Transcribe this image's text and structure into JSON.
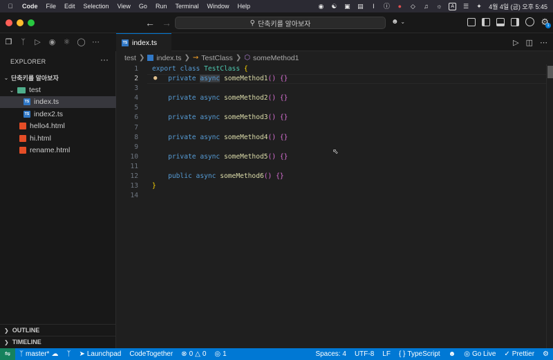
{
  "macos_menubar": {
    "app_name": "Code",
    "menus": [
      "File",
      "Edit",
      "Selection",
      "View",
      "Go",
      "Run",
      "Terminal",
      "Window",
      "Help"
    ],
    "clock": "4월 4일 (금) 오후 5:45",
    "input_badge": "A",
    "status_icons": [
      "record-icon",
      "bug-icon",
      "window-icon",
      "clipboard-icon",
      "cursor-icon",
      "info-icon",
      "profile-icon",
      "layers-icon",
      "wifi-icon",
      "keyboard-icon",
      "control-center-icon",
      "siri-icon"
    ]
  },
  "titlebar": {
    "search_text": "단축키를 알아보자",
    "colors": {
      "close": "#ff5f57",
      "minimize": "#febc2e",
      "maximize": "#28c840"
    },
    "notification_badge": "1"
  },
  "activity_bar": {
    "icons": [
      "files-icon",
      "source-control-icon",
      "run-debug-icon",
      "github-icon",
      "extensions-icon",
      "remote-icon",
      "more-icon"
    ]
  },
  "sidebar": {
    "title": "EXPLORER",
    "more": "···",
    "workspace": "단축키를 알아보자",
    "tree": [
      {
        "label": "test",
        "type": "folder",
        "indent": 1,
        "expanded": true
      },
      {
        "label": "index.ts",
        "type": "ts",
        "indent": 2,
        "selected": true
      },
      {
        "label": "index2.ts",
        "type": "ts",
        "indent": 2
      },
      {
        "label": "hello4.html",
        "type": "html",
        "indent": 1
      },
      {
        "label": "hi.html",
        "type": "html",
        "indent": 1
      },
      {
        "label": "rename.html",
        "type": "html",
        "indent": 1
      }
    ],
    "outline": "OUTLINE",
    "timeline": "TIMELINE"
  },
  "editor_tab": {
    "label": "index.ts",
    "icon_text": "TS"
  },
  "breadcrumb": {
    "folder": "test",
    "file": "index.ts",
    "class": "TestClass",
    "method": "someMethod1"
  },
  "code": {
    "line_numbers": [
      "1",
      "2",
      "3",
      "4",
      "5",
      "6",
      "7",
      "8",
      "9",
      "10",
      "11",
      "12",
      "13",
      "14"
    ],
    "current_line": "2",
    "lines": [
      {
        "parts": [
          [
            "kw",
            "export"
          ],
          [
            "p",
            " "
          ],
          [
            "kw",
            "class"
          ],
          [
            "p",
            " "
          ],
          [
            "cls",
            "TestClass"
          ],
          [
            "p",
            " "
          ],
          [
            "br1",
            "{"
          ]
        ]
      },
      {
        "parts": [
          [
            "p",
            "    "
          ],
          [
            "kw",
            "private"
          ],
          [
            "p",
            " "
          ],
          [
            "sel",
            "async"
          ],
          [
            "p",
            " "
          ],
          [
            "fn",
            "someMethod1"
          ],
          [
            "br2",
            "()"
          ],
          [
            "p",
            " "
          ],
          [
            "br2",
            "{}"
          ]
        ]
      },
      {
        "parts": []
      },
      {
        "parts": [
          [
            "p",
            "    "
          ],
          [
            "kw",
            "private"
          ],
          [
            "p",
            " "
          ],
          [
            "kw",
            "async"
          ],
          [
            "p",
            " "
          ],
          [
            "fn",
            "someMethod2"
          ],
          [
            "br2",
            "()"
          ],
          [
            "p",
            " "
          ],
          [
            "br2",
            "{}"
          ]
        ]
      },
      {
        "parts": []
      },
      {
        "parts": [
          [
            "p",
            "    "
          ],
          [
            "kw",
            "private"
          ],
          [
            "p",
            " "
          ],
          [
            "kw",
            "async"
          ],
          [
            "p",
            " "
          ],
          [
            "fn",
            "someMethod3"
          ],
          [
            "br2",
            "()"
          ],
          [
            "p",
            " "
          ],
          [
            "br2",
            "{}"
          ]
        ]
      },
      {
        "parts": []
      },
      {
        "parts": [
          [
            "p",
            "    "
          ],
          [
            "kw",
            "private"
          ],
          [
            "p",
            " "
          ],
          [
            "kw",
            "async"
          ],
          [
            "p",
            " "
          ],
          [
            "fn",
            "someMethod4"
          ],
          [
            "br2",
            "()"
          ],
          [
            "p",
            " "
          ],
          [
            "br2",
            "{}"
          ]
        ]
      },
      {
        "parts": []
      },
      {
        "parts": [
          [
            "p",
            "    "
          ],
          [
            "kw",
            "private"
          ],
          [
            "p",
            " "
          ],
          [
            "kw",
            "async"
          ],
          [
            "p",
            " "
          ],
          [
            "fn",
            "someMethod5"
          ],
          [
            "br2",
            "()"
          ],
          [
            "p",
            " "
          ],
          [
            "br2",
            "{}"
          ]
        ]
      },
      {
        "parts": []
      },
      {
        "parts": [
          [
            "p",
            "    "
          ],
          [
            "kw",
            "public"
          ],
          [
            "p",
            " "
          ],
          [
            "kw",
            "async"
          ],
          [
            "p",
            " "
          ],
          [
            "fn",
            "someMethod6"
          ],
          [
            "br2",
            "()"
          ],
          [
            "p",
            " "
          ],
          [
            "br2",
            "{}"
          ]
        ]
      },
      {
        "parts": [
          [
            "br1",
            "}"
          ]
        ]
      },
      {
        "parts": []
      }
    ]
  },
  "statusbar": {
    "branch": "master*",
    "launchpad": "Launchpad",
    "codetogether": "CodeTogether",
    "errors": "0",
    "warnings": "0",
    "ports": "1",
    "spaces": "Spaces: 4",
    "encoding": "UTF-8",
    "eol": "LF",
    "language_braces": "{ }",
    "language": "TypeScript",
    "golive": "Go Live",
    "prettier": "Prettier"
  }
}
